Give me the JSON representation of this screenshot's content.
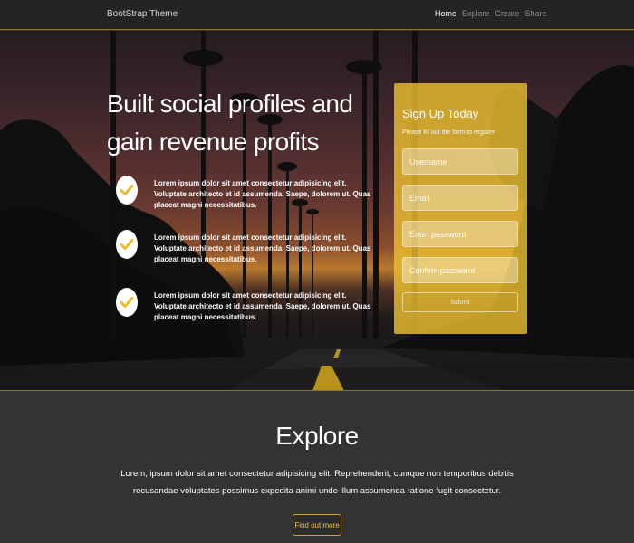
{
  "navbar": {
    "brand": "BootStrap Theme",
    "links": [
      {
        "label": "Home",
        "active": true
      },
      {
        "label": "Explore",
        "active": false
      },
      {
        "label": "Create",
        "active": false
      },
      {
        "label": "Share",
        "active": false
      }
    ]
  },
  "hero": {
    "headline": "Built social profiles and gain revenue profits",
    "features": [
      {
        "icon": "check-icon",
        "text": "Lorem ipsum dolor sit amet consectetur adipisicing elit. Voluptate architecto et id assumenda. Saepe, dolorem ut. Quas placeat magni necessitatibus."
      },
      {
        "icon": "check-icon",
        "text": "Lorem ipsum dolor sit amet consectetur adipisicing elit. Voluptate architecto et id assumenda. Saepe, dolorem ut. Quas placeat magni necessitatibus."
      },
      {
        "icon": "check-icon",
        "text": "Lorem ipsum dolor sit amet consectetur adipisicing elit. Voluptate architecto et id assumenda. Saepe, dolorem ut. Quas placeat magni necessitatibus."
      }
    ]
  },
  "signup": {
    "title": "Sign Up Today",
    "subtitle": "Please fill out the form to register",
    "fields": {
      "username_placeholder": "Username",
      "email_placeholder": "Email",
      "password_placeholder": "Enter password",
      "confirm_placeholder": "Confirm password"
    },
    "submit_label": "Submit"
  },
  "explore": {
    "title": "Explore",
    "text": "Lorem, ipsum dolor sit amet consectetur adipisicing elit. Reprehenderit, cumque non temporibus debitis recusandae voluptates possimus expedita animi unde illum assumenda ratione fugit consectetur.",
    "button_label": "Find out more"
  },
  "colors": {
    "accent": "#eabe30",
    "navbar_bg": "#242424",
    "section_bg": "#333333",
    "check_color": "#eabe30"
  }
}
